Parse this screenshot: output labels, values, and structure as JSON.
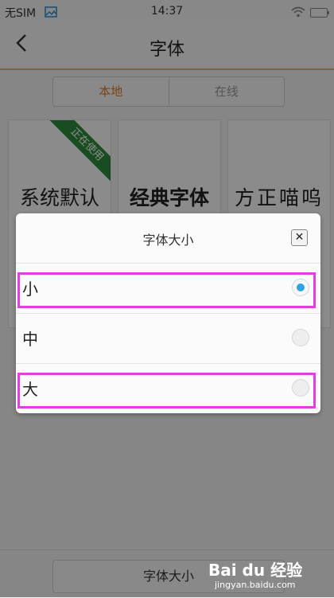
{
  "status": {
    "carrier": "无SIM",
    "time": "14:37"
  },
  "header": {
    "title": "字体"
  },
  "tabs": [
    {
      "label": "本地",
      "active": true
    },
    {
      "label": "在线",
      "active": false
    }
  ],
  "fonts": [
    {
      "name": "系统默认",
      "badge": "正在使用"
    },
    {
      "name": "经典字体"
    },
    {
      "name": "方正喵呜"
    }
  ],
  "bottom": {
    "button_label": "字体大小"
  },
  "dialog": {
    "title": "字体大小",
    "options": [
      {
        "label": "小",
        "selected": true
      },
      {
        "label": "中",
        "selected": false
      },
      {
        "label": "大",
        "selected": false
      }
    ]
  },
  "watermark": {
    "brand": "Bai du 经验",
    "url": "jingyan.baidu.com"
  },
  "colors": {
    "accent": "#e07b28",
    "radio_selected": "#2ea4e6",
    "highlight": "#e040e0",
    "ribbon": "#2f8a3c"
  }
}
